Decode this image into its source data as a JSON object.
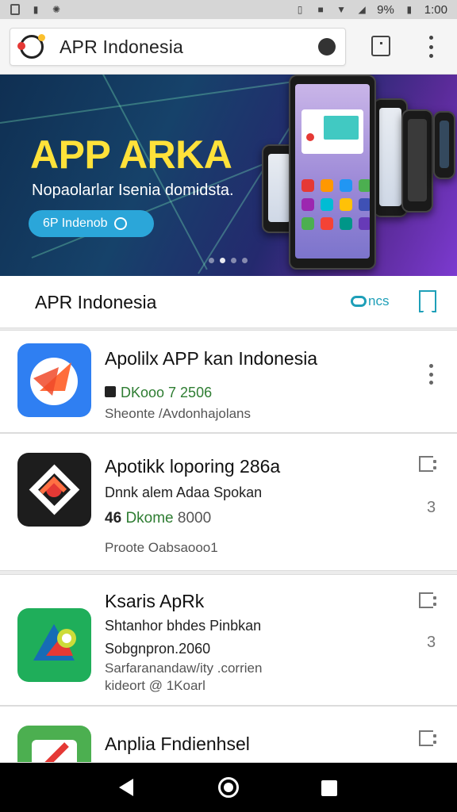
{
  "status_bar": {
    "battery_text": "9%",
    "time": "1:00",
    "left_icons": [
      "sim-icon",
      "flashlight-icon",
      "settings-icon"
    ],
    "right_icons": [
      "vibrate-icon",
      "lock-icon",
      "wifi-icon",
      "signal-icon",
      "battery-icon"
    ]
  },
  "browser": {
    "url": "APR Indonesia",
    "actions": [
      "tabs-icon",
      "more-vert-icon"
    ]
  },
  "banner": {
    "title": "APP ARKA",
    "subtitle": "Nopaolarlar Isenia domidsta.",
    "cta": "6P Indenob",
    "slides": 4,
    "active_slide": 0
  },
  "section": {
    "title": "APR Indonesia",
    "link": "ncs"
  },
  "apps": [
    {
      "name": "Apolilx APP kan  Indonesia",
      "line1": "DKooo 7 2506",
      "line2": "Sheonte /Avdonhajolans",
      "icon_colors": [
        "#2f86f6",
        "#ff7043",
        "#ffffff"
      ]
    },
    {
      "name": "Apotikk loporing 286a",
      "line1": "Dnnk alem Adaa Spokan",
      "line2_prefix": "4",
      "line2_prefix2": "6",
      "line2_green": "Dkome",
      "line2_rest": "8000",
      "line3": "Proote Oabsaooo1",
      "count": "3"
    },
    {
      "name": "Ksaris ApRk",
      "line1": "Shtanhor bhdes Pinbkan",
      "line2": "Sobgnpron.2060",
      "line3": "Sarfaranandaw/ity .corrien",
      "line4": "kideort @ 1Koarl",
      "count": "3"
    },
    {
      "name": "Anplia Fndienhsel",
      "line1": ""
    }
  ],
  "nav": {
    "back": "back-icon",
    "home": "home-icon",
    "recent": "recent-apps-icon"
  }
}
